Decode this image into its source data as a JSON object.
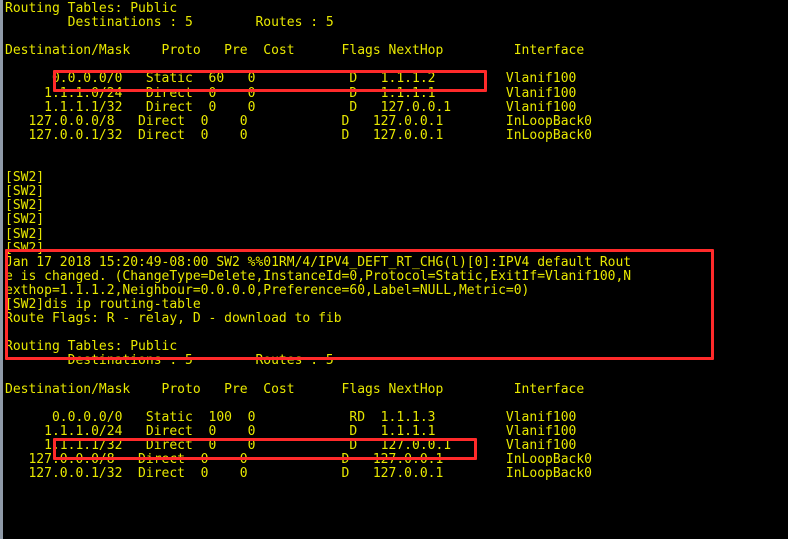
{
  "terminal": {
    "device_prompt": "[SW2]",
    "foreground_color": "#e8e800",
    "background_color": "#000000",
    "highlight_color": "#ff2a2a",
    "lines": [
      "Routing Tables: Public",
      "        Destinations : 5        Routes : 5",
      "",
      "Destination/Mask    Proto   Pre  Cost      Flags NextHop         Interface",
      "",
      "      0.0.0.0/0   Static  60   0            D   1.1.1.2         Vlanif100",
      "     1.1.1.0/24   Direct  0    0            D   1.1.1.1         Vlanif100",
      "     1.1.1.1/32   Direct  0    0            D   127.0.0.1       Vlanif100",
      "   127.0.0.0/8   Direct  0    0            D   127.0.0.1        InLoopBack0",
      "   127.0.0.1/32  Direct  0    0            D   127.0.0.1        InLoopBack0",
      "",
      "",
      "[SW2]",
      "[SW2]",
      "[SW2]",
      "[SW2]",
      "[SW2]",
      "[SW2]",
      "Jan 17 2018 15:20:49-08:00 SW2 %%01RM/4/IPV4_DEFT_RT_CHG(l)[0]:IPV4 default Rout",
      "e is changed. (ChangeType=Delete,InstanceId=0,Protocol=Static,ExitIf=Vlanif100,N",
      "exthop=1.1.1.2,Neighbour=0.0.0.0,Preference=60,Label=NULL,Metric=0)",
      "[SW2]dis ip routing-table",
      "Route Flags: R - relay, D - download to fib",
      "",
      "Routing Tables: Public",
      "        Destinations : 5        Routes : 5",
      "",
      "Destination/Mask    Proto   Pre  Cost      Flags NextHop         Interface",
      "",
      "      0.0.0.0/0   Static  100  0            RD  1.1.1.3         Vlanif100",
      "     1.1.1.0/24   Direct  0    0            D   1.1.1.1         Vlanif100",
      "     1.1.1.1/32   Direct  0    0            D   127.0.0.1       Vlanif100",
      "   127.0.0.0/8   Direct  0    0            D   127.0.0.1        InLoopBack0",
      "   127.0.0.1/32  Direct  0    0            D   127.0.0.1        InLoopBack0"
    ]
  },
  "routing_table_1": {
    "title": "Routing Tables: Public",
    "destinations": "5",
    "routes": "5",
    "columns": [
      "Destination/Mask",
      "Proto",
      "Pre",
      "Cost",
      "Flags",
      "NextHop",
      "Interface"
    ],
    "rows": [
      {
        "destination": "0.0.0.0/0",
        "proto": "Static",
        "pre": "60",
        "cost": "0",
        "flags": "D",
        "nexthop": "1.1.1.2",
        "interface": "Vlanif100",
        "highlighted": true
      },
      {
        "destination": "1.1.1.0/24",
        "proto": "Direct",
        "pre": "0",
        "cost": "0",
        "flags": "D",
        "nexthop": "1.1.1.1",
        "interface": "Vlanif100",
        "highlighted": false
      },
      {
        "destination": "1.1.1.1/32",
        "proto": "Direct",
        "pre": "0",
        "cost": "0",
        "flags": "D",
        "nexthop": "127.0.0.1",
        "interface": "Vlanif100",
        "highlighted": false
      },
      {
        "destination": "127.0.0.0/8",
        "proto": "Direct",
        "pre": "0",
        "cost": "0",
        "flags": "D",
        "nexthop": "127.0.0.1",
        "interface": "InLoopBack0",
        "highlighted": false
      },
      {
        "destination": "127.0.0.1/32",
        "proto": "Direct",
        "pre": "0",
        "cost": "0",
        "flags": "D",
        "nexthop": "127.0.0.1",
        "interface": "InLoopBack0",
        "highlighted": false
      }
    ]
  },
  "log_message": {
    "timestamp": "Jan 17 2018 15:20:49-08:00",
    "host": "SW2",
    "code": "%%01RM/4/IPV4_DEFT_RT_CHG(l)[0]",
    "text": "IPV4 default Route is changed. (ChangeType=Delete,InstanceId=0,Protocol=Static,ExitIf=Vlanif100,Nexthop=1.1.1.2,Neighbour=0.0.0.0,Preference=60,Label=NULL,Metric=0)"
  },
  "command": {
    "prompt": "[SW2]",
    "text": "dis ip routing-table"
  },
  "route_flags_legend": "Route Flags: R - relay, D - download to fib",
  "routing_table_2": {
    "title": "Routing Tables: Public",
    "destinations": "5",
    "routes": "5",
    "columns": [
      "Destination/Mask",
      "Proto",
      "Pre",
      "Cost",
      "Flags",
      "NextHop",
      "Interface"
    ],
    "rows": [
      {
        "destination": "0.0.0.0/0",
        "proto": "Static",
        "pre": "100",
        "cost": "0",
        "flags": "RD",
        "nexthop": "1.1.1.3",
        "interface": "Vlanif100",
        "highlighted": true
      },
      {
        "destination": "1.1.1.0/24",
        "proto": "Direct",
        "pre": "0",
        "cost": "0",
        "flags": "D",
        "nexthop": "1.1.1.1",
        "interface": "Vlanif100",
        "highlighted": false
      },
      {
        "destination": "1.1.1.1/32",
        "proto": "Direct",
        "pre": "0",
        "cost": "0",
        "flags": "D",
        "nexthop": "127.0.0.1",
        "interface": "Vlanif100",
        "highlighted": false
      },
      {
        "destination": "127.0.0.0/8",
        "proto": "Direct",
        "pre": "0",
        "cost": "0",
        "flags": "D",
        "nexthop": "127.0.0.1",
        "interface": "InLoopBack0",
        "highlighted": false
      },
      {
        "destination": "127.0.0.1/32",
        "proto": "Direct",
        "pre": "0",
        "cost": "0",
        "flags": "D",
        "nexthop": "127.0.0.1",
        "interface": "InLoopBack0",
        "highlighted": false
      }
    ]
  },
  "annotations": [
    {
      "name": "highlight-default-route-before",
      "label": ""
    },
    {
      "name": "highlight-log-and-command",
      "label": ""
    },
    {
      "name": "highlight-default-route-after",
      "label": ""
    }
  ]
}
